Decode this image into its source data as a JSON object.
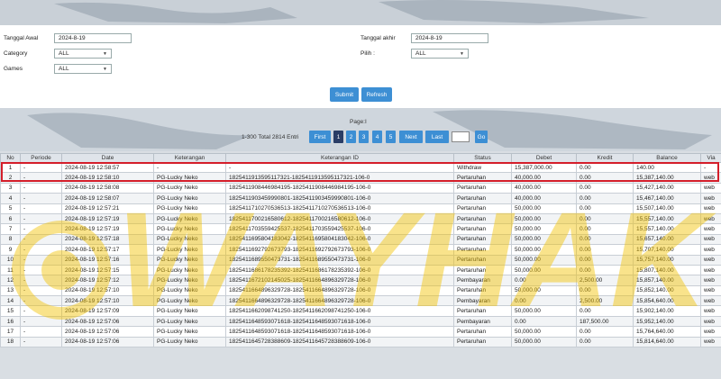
{
  "filters": {
    "tanggal_awal_label": "Tanggal Awal",
    "tanggal_awal_value": "2024-8-19",
    "tanggal_akhir_label": "Tanggal akhir",
    "tanggal_akhir_value": "2024-8-19",
    "category_label": "Category",
    "category_value": "ALL",
    "pilih_label": "Pilih :",
    "pilih_value": "ALL",
    "games_label": "Games",
    "games_value": "ALL"
  },
  "buttons": {
    "submit": "Submit",
    "refresh": "Refresh"
  },
  "pager": {
    "page_label": "Page:I",
    "total_label": "1-300 Total 2814 Entri",
    "first": "First",
    "pages": [
      "1",
      "2",
      "3",
      "4",
      "5"
    ],
    "next": "Next",
    "last": "Last",
    "go": "Go",
    "input_value": "1"
  },
  "table": {
    "headers": [
      "No",
      "Periode",
      "Date",
      "Keterangan",
      "Keterangan ID",
      "Status",
      "Debet",
      "Kredit",
      "Balance",
      "Via"
    ],
    "rows": [
      [
        "1",
        "-",
        "2024-08-19 12:58:57",
        "-",
        "-",
        "Withdraw",
        "15,387,000.00",
        "0.00",
        "140.00",
        "-"
      ],
      [
        "2",
        "-",
        "2024-08-19 12:58:10",
        "PG-Lucky Neko",
        "1825411913595117321-1825411913595117321-106-0",
        "Pertaruhan",
        "40,000.00",
        "0.00",
        "15,387,140.00",
        "web"
      ],
      [
        "3",
        "-",
        "2024-08-19 12:58:08",
        "PG-Lucky Neko",
        "1825411908446984195-1825411908446984195-106-0",
        "Pertaruhan",
        "40,000.00",
        "0.00",
        "15,427,140.00",
        "web"
      ],
      [
        "4",
        "-",
        "2024-08-19 12:58:07",
        "PG-Lucky Neko",
        "1825411903459990801-1825411903459990801-106-0",
        "Pertaruhan",
        "40,000.00",
        "0.00",
        "15,467,140.00",
        "web"
      ],
      [
        "5",
        "-",
        "2024-08-19 12:57:21",
        "PG-Lucky Neko",
        "1825411710270536513-1825411710270536513-106-0",
        "Pertaruhan",
        "50,000.00",
        "0.00",
        "15,507,140.00",
        "web"
      ],
      [
        "6",
        "-",
        "2024-08-19 12:57:19",
        "PG-Lucky Neko",
        "1825411700216580612-1825411700216580612-106-0",
        "Pertaruhan",
        "50,000.00",
        "0.00",
        "15,557,140.00",
        "web"
      ],
      [
        "7",
        "-",
        "2024-08-19 12:57:19",
        "PG-Lucky Neko",
        "1825411703559425537-1825411703559425537-106-0",
        "Pertaruhan",
        "50,000.00",
        "0.00",
        "15,557,140.00",
        "web"
      ],
      [
        "8",
        "-",
        "2024-08-19 12:57:18",
        "PG-Lucky Neko",
        "1825411695804183042-1825411695804183042-106-0",
        "Pertaruhan",
        "50,000.00",
        "0.00",
        "15,657,140.00",
        "web"
      ],
      [
        "9",
        "-",
        "2024-08-19 12:57:17",
        "PG-Lucky Neko",
        "1825411692792673793-1825411692792673793-106-0",
        "Pertaruhan",
        "50,000.00",
        "0.00",
        "15,707,140.00",
        "web"
      ],
      [
        "10",
        "-",
        "2024-08-19 12:57:16",
        "PG-Lucky Neko",
        "1825411689550473731-1825411689550473731-106-0",
        "Pertaruhan",
        "50,000.00",
        "0.00",
        "15,757,140.00",
        "web"
      ],
      [
        "11",
        "-",
        "2024-08-19 12:57:15",
        "PG-Lucky Neko",
        "1825411686178235392-1825411686178235392-106-0",
        "Pertaruhan",
        "50,000.00",
        "0.00",
        "15,807,140.00",
        "web"
      ],
      [
        "12",
        "-",
        "2024-08-19 12:57:12",
        "PG-Lucky Neko",
        "1825411672102145025-1825411664896329728-106-0",
        "Pembayaran",
        "0.00",
        "2,500.00",
        "15,857,140.00",
        "web"
      ],
      [
        "13",
        "-",
        "2024-08-19 12:57:10",
        "PG-Lucky Neko",
        "1825411664896329728-1825411664896329728-106-0",
        "Pertaruhan",
        "50,000.00",
        "0.00",
        "15,852,140.00",
        "web"
      ],
      [
        "14",
        "-",
        "2024-08-19 12:57:10",
        "PG-Lucky Neko",
        "1825411664896329728-1825411664896329728-106-0",
        "Pembayaran",
        "0.00",
        "2,500.00",
        "15,854,640.00",
        "web"
      ],
      [
        "15",
        "-",
        "2024-08-19 12:57:09",
        "PG-Lucky Neko",
        "1825411662098741250-1825411662098741250-106-0",
        "Pertaruhan",
        "50,000.00",
        "0.00",
        "15,902,140.00",
        "web"
      ],
      [
        "16",
        "-",
        "2024-08-19 12:57:06",
        "PG-Lucky Neko",
        "1825411648593071618-1825411648593071618-106-0",
        "Pembayaran",
        "0.00",
        "187,500.00",
        "15,952,140.00",
        "web"
      ],
      [
        "17",
        "-",
        "2024-08-19 12:57:06",
        "PG-Lucky Neko",
        "1825411648593071618-1825411648593071618-106-0",
        "Pertaruhan",
        "50,000.00",
        "0.00",
        "15,764,640.00",
        "web"
      ],
      [
        "18",
        "-",
        "2024-08-19 12:57:06",
        "PG-Lucky Neko",
        "1825411645728388609-1825411645728388609-106-0",
        "Pertaruhan",
        "50,000.00",
        "0.00",
        "15,814,640.00",
        "web"
      ]
    ]
  },
  "watermark_text": "WAYHAK",
  "colors": {
    "accent": "#3d8fd4",
    "highlight": "#d41e2a",
    "link": "#2b6cb0",
    "debit_red": "#d12020"
  }
}
